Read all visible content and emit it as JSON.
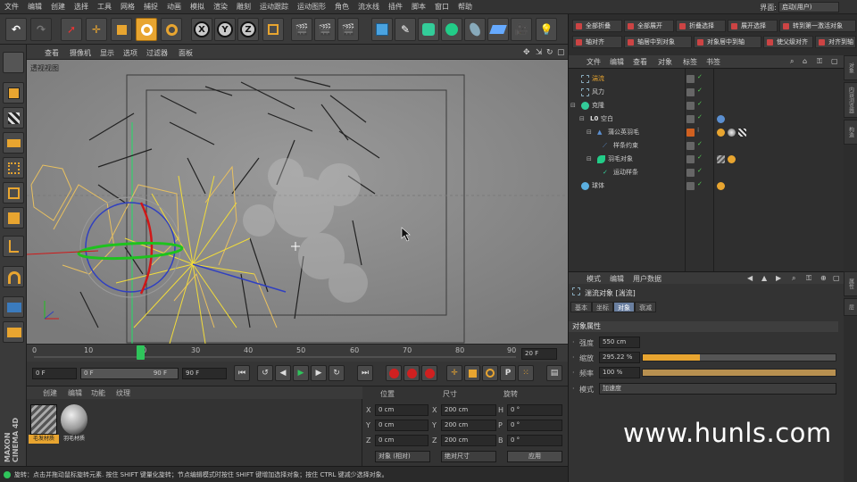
{
  "menubar": {
    "items": [
      "文件",
      "编辑",
      "创建",
      "选择",
      "工具",
      "网格",
      "捕捉",
      "动画",
      "模拟",
      "渲染",
      "雕刻",
      "运动跟踪",
      "运动图形",
      "角色",
      "流水线",
      "插件",
      "脚本",
      "窗口",
      "帮助"
    ],
    "layout_label": "界面:",
    "layout_value": "启动(用户)"
  },
  "viewport": {
    "menu": [
      "查看",
      "摄像机",
      "显示",
      "选项",
      "过滤器",
      "面板"
    ],
    "label": "透视视图"
  },
  "timeline": {
    "ticks": [
      "0",
      "10",
      "20",
      "30",
      "40",
      "50",
      "60",
      "70",
      "80",
      "90"
    ],
    "current": "20",
    "end_field": "20 F"
  },
  "transport": {
    "start": "0 F",
    "range_start": "0 F",
    "range_end": "90 F",
    "end": "90 F"
  },
  "materials": {
    "menu": [
      "创建",
      "编辑",
      "功能",
      "纹理"
    ],
    "items": [
      {
        "label": "毛发材质"
      },
      {
        "label": "羽毛材质"
      }
    ]
  },
  "coords": {
    "headers": {
      "position": "位置",
      "size": "尺寸",
      "rotation": "旋转"
    },
    "rows": [
      {
        "axis": "X",
        "pos": "0 cm",
        "size_axis": "X",
        "size": "200 cm",
        "rot_axis": "H",
        "rot": "0 °"
      },
      {
        "axis": "Y",
        "pos": "0 cm",
        "size_axis": "Y",
        "size": "200 cm",
        "rot_axis": "P",
        "rot": "0 °"
      },
      {
        "axis": "Z",
        "pos": "0 cm",
        "size_axis": "Z",
        "size": "200 cm",
        "rot_axis": "B",
        "rot": "0 °"
      }
    ],
    "mode_object": "对象 (相对)",
    "mode_size": "绝对尺寸",
    "apply": "应用"
  },
  "status": "旋转：点击并拖动鼠标旋转元素. 按住 SHIFT 键量化旋转；节点编辑模式时按住 SHIFT 键增加选择对象；按住 CTRL 键减少选择对象。",
  "right_toolbar": {
    "row1": [
      "全部折叠",
      "全部展开",
      "折叠选择",
      "展开选择",
      "转到第一激活对象"
    ],
    "row2": [
      "轴对齐",
      "轴居中到对象",
      "对象居中到轴",
      "使父级对齐",
      "对齐到轴"
    ]
  },
  "object_manager": {
    "menu": [
      "文件",
      "编辑",
      "查看",
      "对象",
      "标签",
      "书签"
    ],
    "rows": [
      {
        "name": "湍流",
        "indent": 0,
        "color": "#e8a530"
      },
      {
        "name": "风力",
        "indent": 0,
        "color": "#ccc"
      },
      {
        "name": "克隆",
        "indent": 0,
        "color": "#ccc"
      },
      {
        "name": "空白",
        "indent": 1,
        "color": "#ccc"
      },
      {
        "name": "蒲公英羽毛",
        "indent": 2,
        "color": "#ccc"
      },
      {
        "name": "样条约束",
        "indent": 3,
        "color": "#ccc"
      },
      {
        "name": "羽毛对象",
        "indent": 2,
        "color": "#ccc"
      },
      {
        "name": "运动样条",
        "indent": 3,
        "color": "#ccc"
      },
      {
        "name": "球体",
        "indent": 0,
        "color": "#ccc"
      }
    ]
  },
  "attributes": {
    "menu": [
      "模式",
      "编辑",
      "用户数据"
    ],
    "title": "湍流对象 [湍流]",
    "tabs": [
      "基本",
      "坐标",
      "对象",
      "衰减"
    ],
    "active_tab": "对象",
    "section": "对象属性",
    "fields": [
      {
        "label": "强度",
        "value": "550 cm"
      },
      {
        "label": "缩放",
        "value": "295.22 %",
        "fill": 0.295
      },
      {
        "label": "频率",
        "value": "100 %",
        "fill": 1.0
      }
    ],
    "mode_label": "模式",
    "mode_value": "加速度"
  },
  "side_tabs_top": [
    "对象",
    "内容浏览器",
    "构造"
  ],
  "side_tabs_bottom": [
    "属性",
    "层"
  ],
  "watermark": "www.hunls.com",
  "logo": "MAXON CINEMA 4D",
  "colors": {
    "accent": "#e8a530",
    "bg": "#2d2d2d",
    "viewport": "#8a8a8a"
  }
}
